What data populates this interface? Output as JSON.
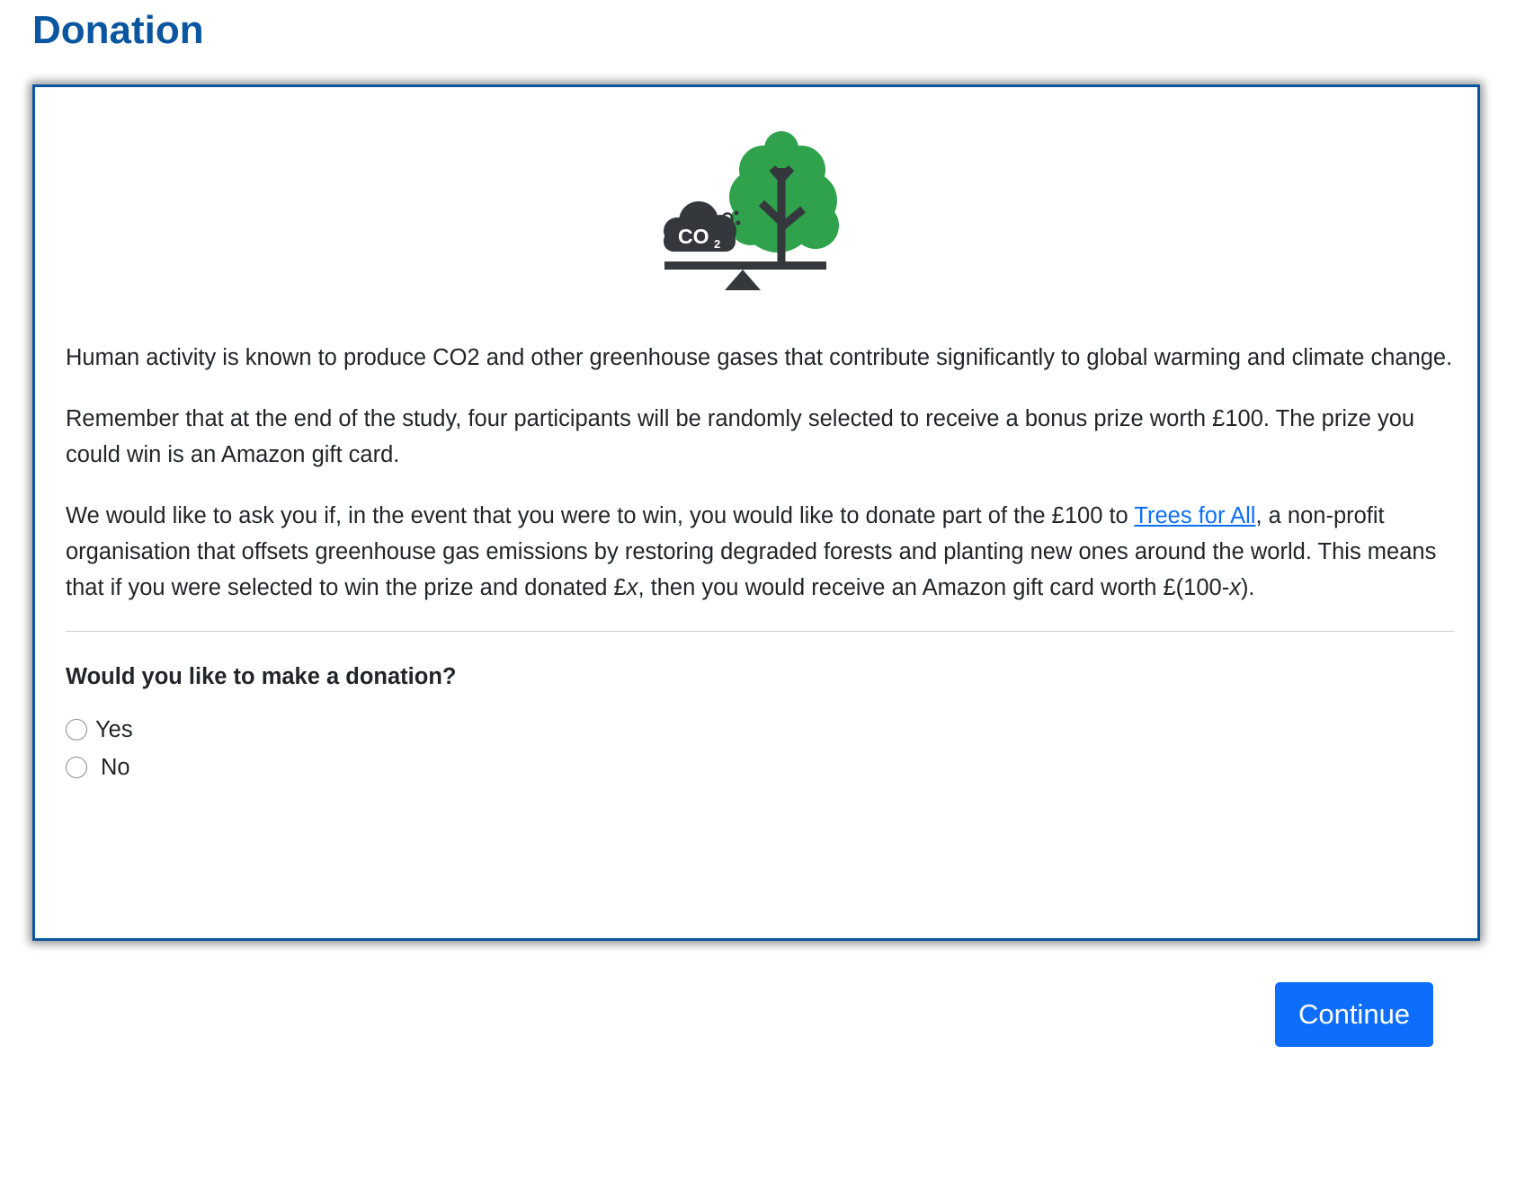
{
  "page": {
    "title": "Donation"
  },
  "illustration": {
    "icon": "co2-tree-balance-icon",
    "badge_text": "CO",
    "badge_subscript": "2",
    "colors": {
      "tree": "#2fa24b",
      "dark": "#34383c"
    }
  },
  "paragraphs": {
    "p1": "Human activity is known to produce CO2 and other greenhouse gases that contribute significantly to global warming and climate change.",
    "p2": "Remember that at the end of the study, four participants will be randomly selected to receive a bonus prize worth £100. The prize you could win is an Amazon gift card.",
    "p3_before_link": "We would like to ask you if, in the event that you were to win, you would like to donate part of the £100 to ",
    "p3_link": "Trees for All",
    "p3_after_link_1": ", a non-profit organisation that offsets greenhouse gas emissions by restoring degraded forests and planting new ones around the world. This means that if you were selected to win the prize and donated £",
    "p3_x1": "x",
    "p3_after_link_2": ", then you would receive an Amazon gift card worth £(100-",
    "p3_x2": "x",
    "p3_end": ")."
  },
  "question": {
    "label": "Would you like to make a donation?",
    "options": [
      {
        "label": "Yes",
        "selected": false
      },
      {
        "label": "No",
        "selected": false
      }
    ]
  },
  "actions": {
    "continue_label": "Continue"
  },
  "colors": {
    "title": "#0a56a0",
    "border": "#0a56a0",
    "link": "#0d6efd",
    "button": "#0d6efd"
  }
}
